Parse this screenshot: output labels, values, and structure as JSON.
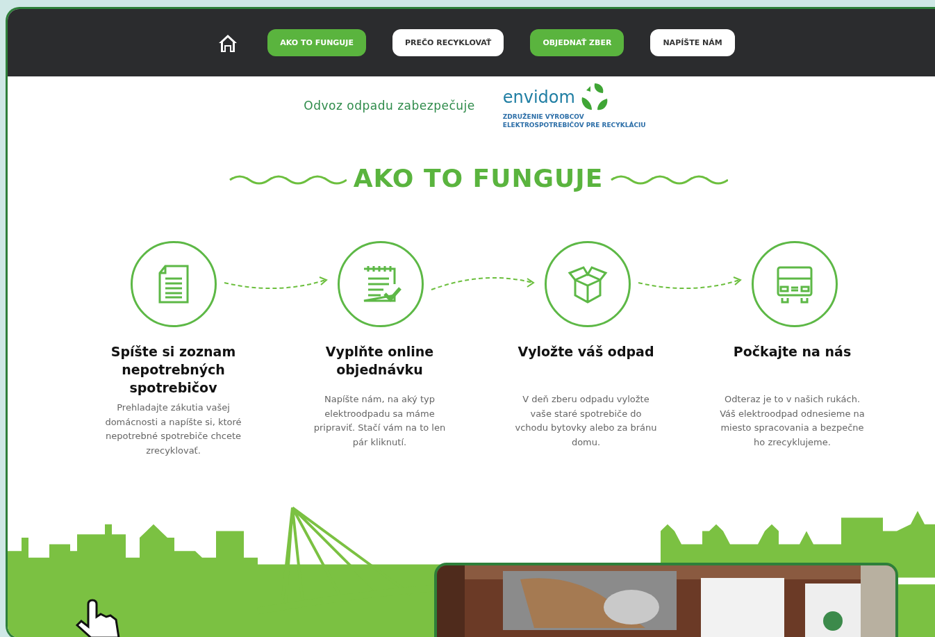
{
  "nav": [
    {
      "label": "AKO TO FUNGUJE",
      "kind": "accent"
    },
    {
      "label": "PREČO RECYKLOVAŤ",
      "kind": "plain"
    },
    {
      "label": "OBJEDNAŤ ZBER",
      "kind": "accent"
    },
    {
      "label": "NAPÍŠTE NÁM",
      "kind": "plain"
    }
  ],
  "sponsor": {
    "text": "Odvoz odpadu zabezpečuje",
    "logo_name": "envidom",
    "logo_tagline": [
      "ZDRUŽENIE VÝROBCOV",
      "ELEKTROSPOTREBIČOV PRE RECYKLÁCIU"
    ]
  },
  "section_title": "AKO TO FUNGUJE",
  "steps": [
    {
      "kind": "document",
      "title": "Spíšte si zoznam nepotrebných spotrebičov",
      "text": "Prehladajte zákutia vašej domácnosti a napíšte si, ktoré nepotrebné spotrebiče chcete zrecyklovať."
    },
    {
      "kind": "checklist",
      "title": "Vyplňte online objednávku",
      "text": "Napíšte nám, na aký typ elektroodpadu sa máme pripraviť. Stačí vám na to len pár kliknutí."
    },
    {
      "kind": "box",
      "title": "Vyložte váš odpad",
      "text": "V deň zberu odpadu vyložte vaše staré spotrebiče do vchodu bytovky alebo za bránu domu."
    },
    {
      "kind": "truck",
      "title": "Počkajte na nás",
      "text": "Odteraz je to v našich rukách. Váš elektroodpad odnesieme na miesto spracovania a bezpečne ho zrecyklujeme."
    }
  ]
}
